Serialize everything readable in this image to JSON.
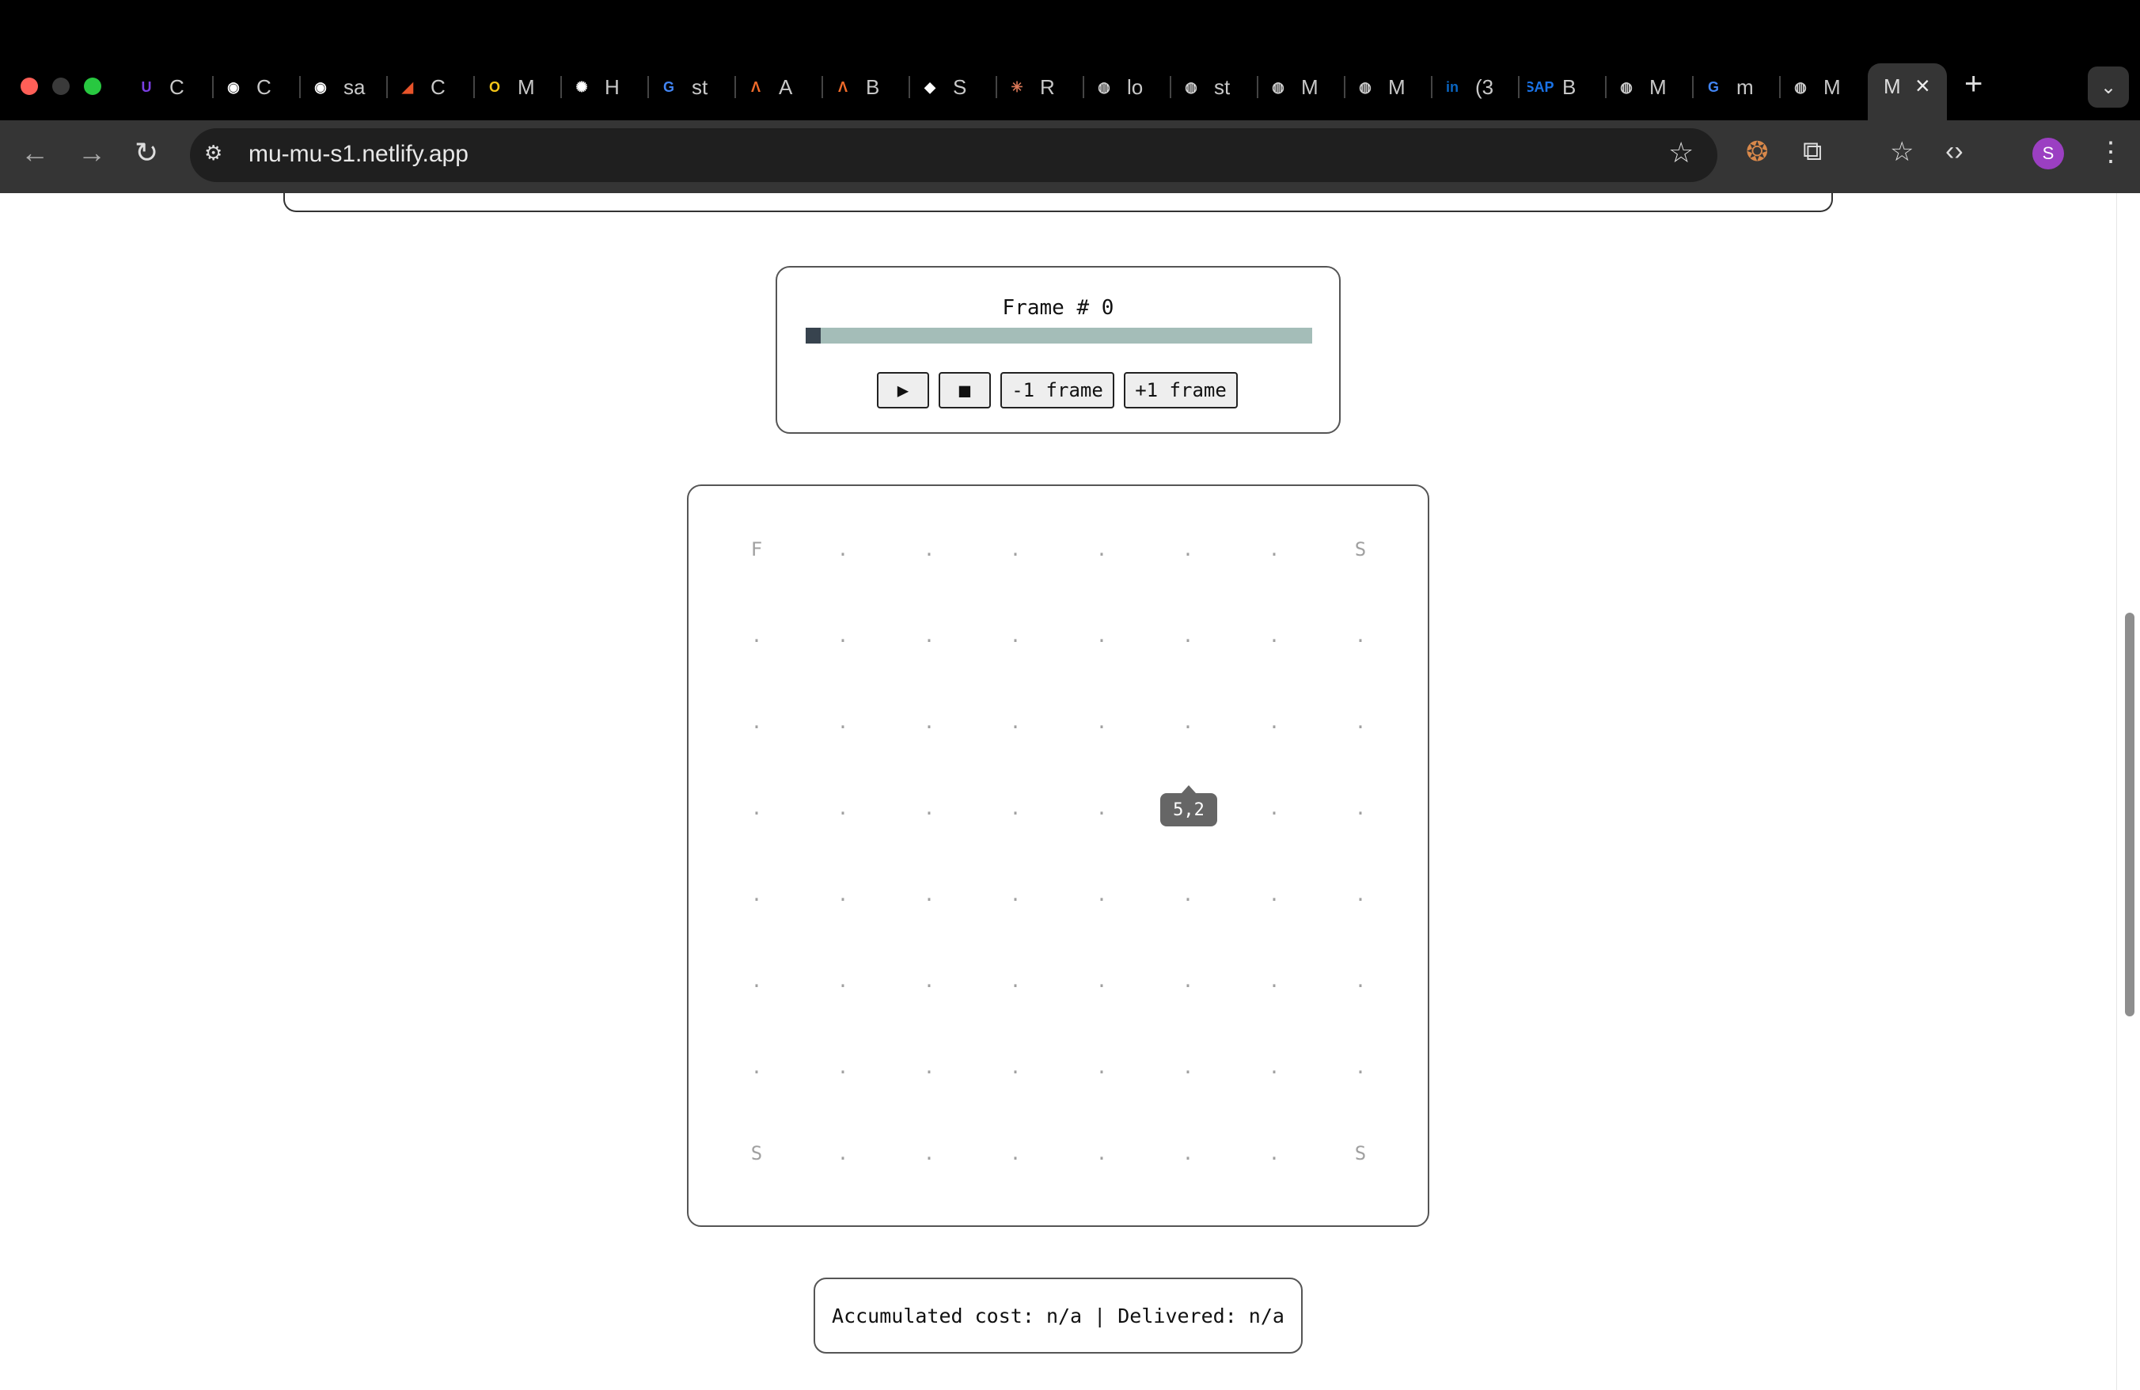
{
  "browser": {
    "tabs": [
      {
        "label": "C",
        "icon": "u-icon",
        "color": "#7b3fe4",
        "glyph": "U"
      },
      {
        "label": "C",
        "icon": "github-icon",
        "color": "#ffffff",
        "glyph": "◉"
      },
      {
        "label": "sa",
        "icon": "github-icon",
        "color": "#ffffff",
        "glyph": "◉"
      },
      {
        "label": "C",
        "icon": "cloud-icon",
        "color": "#e8542a",
        "glyph": "◢"
      },
      {
        "label": "M",
        "icon": "app-icon",
        "color": "#f5c518",
        "glyph": "O"
      },
      {
        "label": "H",
        "icon": "openai-icon",
        "color": "#ffffff",
        "glyph": "✺"
      },
      {
        "label": "st",
        "icon": "google-icon",
        "color": "#4285f4",
        "glyph": "G"
      },
      {
        "label": "A",
        "icon": "a-icon",
        "color": "#f26b2a",
        "glyph": "Ʌ"
      },
      {
        "label": "B",
        "icon": "a-icon",
        "color": "#f26b2a",
        "glyph": "Ʌ"
      },
      {
        "label": "S",
        "icon": "compass-icon",
        "color": "#ffffff",
        "glyph": "◆"
      },
      {
        "label": "R",
        "icon": "claude-icon",
        "color": "#d97757",
        "glyph": "✳"
      },
      {
        "label": "lo",
        "icon": "globe-icon",
        "color": "#cccccc",
        "glyph": "◍"
      },
      {
        "label": "st",
        "icon": "globe-icon",
        "color": "#cccccc",
        "glyph": "◍"
      },
      {
        "label": "M",
        "icon": "globe-icon",
        "color": "#cccccc",
        "glyph": "◍"
      },
      {
        "label": "M",
        "icon": "globe-icon",
        "color": "#cccccc",
        "glyph": "◍"
      },
      {
        "label": "(3",
        "icon": "linkedin-icon",
        "color": "#0a66c2",
        "glyph": "in"
      },
      {
        "label": "B",
        "icon": "sap-icon",
        "color": "#1a73e8",
        "glyph": "SAP"
      },
      {
        "label": "M",
        "icon": "globe-icon",
        "color": "#cccccc",
        "glyph": "◍"
      },
      {
        "label": "m",
        "icon": "google-icon",
        "color": "#4285f4",
        "glyph": "G"
      },
      {
        "label": "M",
        "icon": "globe-icon",
        "color": "#cccccc",
        "glyph": "◍"
      }
    ],
    "active_tab_label": "M",
    "url": "mu-mu-s1.netlify.app"
  },
  "player": {
    "frame_label": "Frame # 0",
    "progress_fraction": 0.03,
    "play_label": "▶",
    "stop_label": "■",
    "prev_label": "-1 frame",
    "next_label": "+1 frame"
  },
  "grid": {
    "rows": [
      [
        "F",
        ".",
        ".",
        ".",
        ".",
        ".",
        ".",
        "S"
      ],
      [
        ".",
        ".",
        ".",
        ".",
        ".",
        ".",
        ".",
        "."
      ],
      [
        ".",
        ".",
        ".",
        ".",
        ".",
        ".",
        ".",
        "."
      ],
      [
        ".",
        ".",
        ".",
        ".",
        ".",
        ".",
        ".",
        "."
      ],
      [
        ".",
        ".",
        ".",
        ".",
        ".",
        ".",
        ".",
        "."
      ],
      [
        ".",
        ".",
        ".",
        ".",
        ".",
        ".",
        ".",
        "."
      ],
      [
        ".",
        ".",
        ".",
        ".",
        ".",
        ".",
        ".",
        "."
      ],
      [
        "S",
        ".",
        ".",
        ".",
        ".",
        ".",
        ".",
        "S"
      ]
    ],
    "tooltip": "5,2"
  },
  "status": {
    "text": "Accumulated cost: n/a | Delivered: n/a"
  },
  "colors": {
    "grid_text": "#a0a0a0",
    "progress_track": "#a4bdb8",
    "progress_fill": "#37434e"
  }
}
